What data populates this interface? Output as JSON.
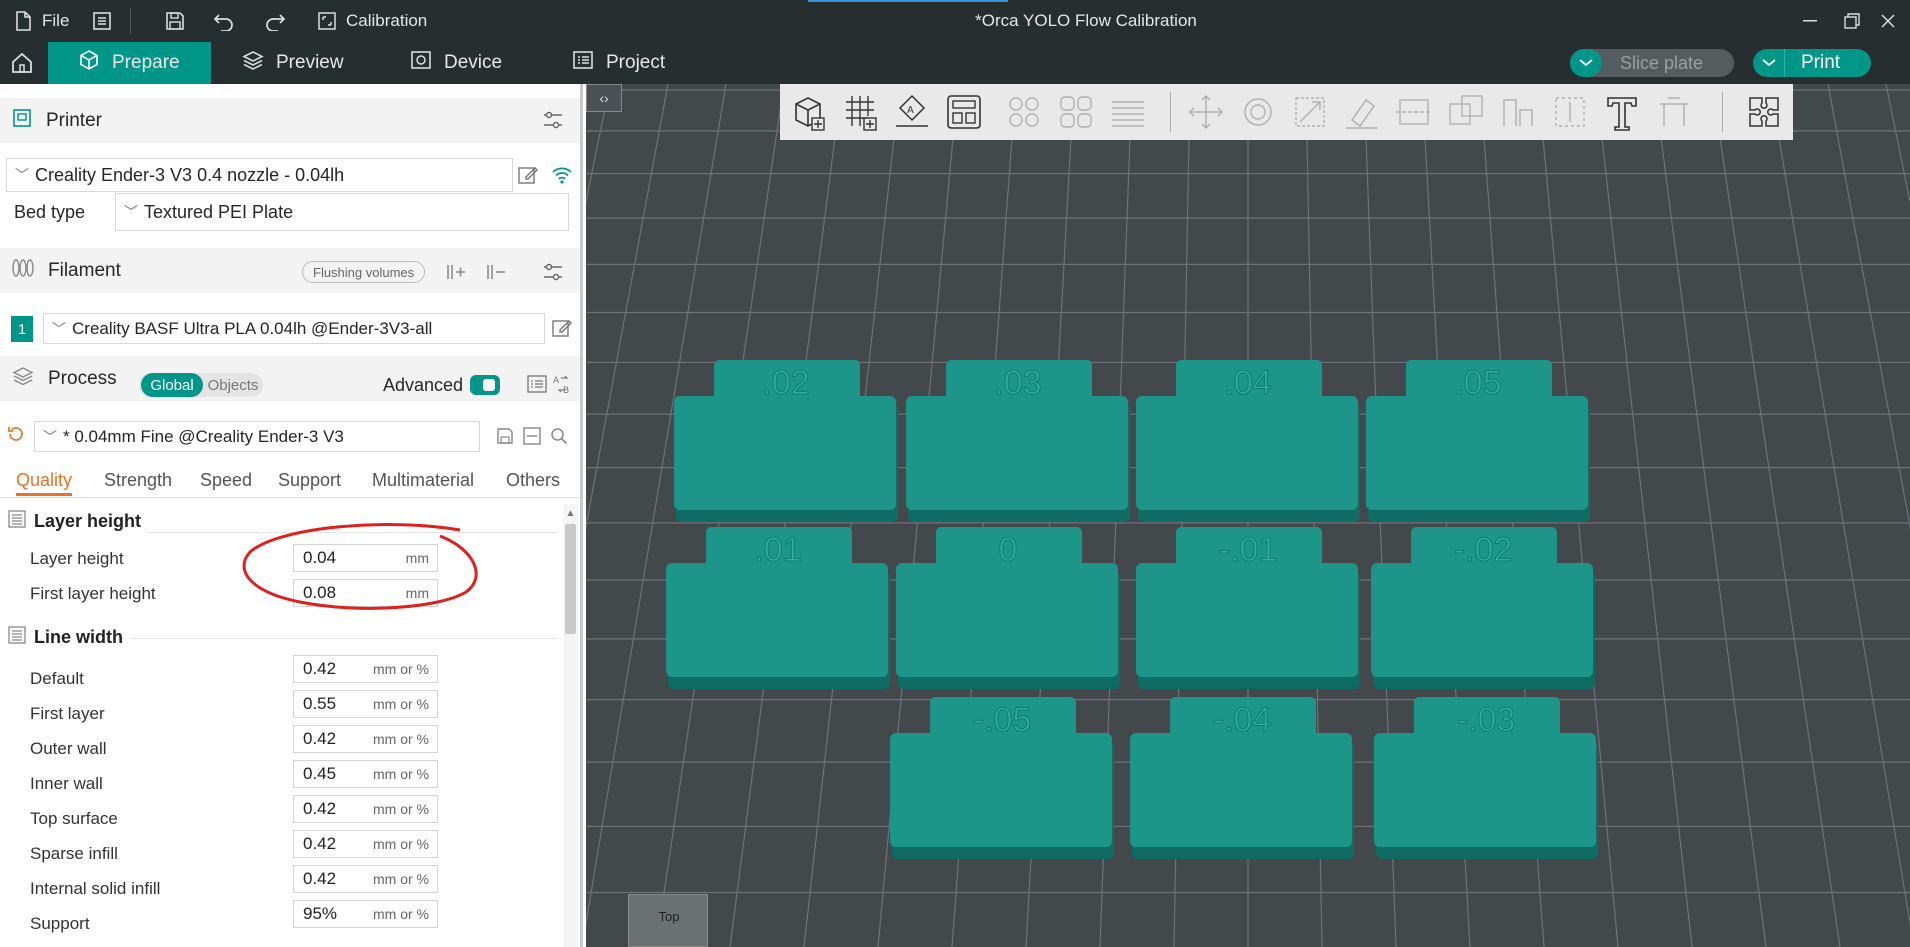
{
  "title_bar": {
    "file_label": "File",
    "calibration_label": "Calibration",
    "window_title": "*Orca YOLO Flow Calibration"
  },
  "tabs": [
    {
      "label": "Prepare",
      "icon": "cube-icon"
    },
    {
      "label": "Preview",
      "icon": "layers-icon"
    },
    {
      "label": "Device",
      "icon": "device-icon"
    },
    {
      "label": "Project",
      "icon": "project-icon"
    }
  ],
  "actions": {
    "slice_label": "Slice plate",
    "print_label": "Print"
  },
  "printer": {
    "section_label": "Printer",
    "preset": "Creality Ender-3 V3 0.4 nozzle - 0.04lh",
    "bed_type_label": "Bed type",
    "bed_type_value": "Textured PEI Plate"
  },
  "filament": {
    "section_label": "Filament",
    "flushing_label": "Flushing volumes",
    "slot_number": "1",
    "preset": "Creality BASF Ultra PLA 0.04lh @Ender-3V3-all"
  },
  "process": {
    "section_label": "Process",
    "global_label": "Global",
    "objects_label": "Objects",
    "advanced_label": "Advanced",
    "preset": "* 0.04mm Fine @Creality Ender-3 V3"
  },
  "subtabs": [
    "Quality",
    "Strength",
    "Speed",
    "Support",
    "Multimaterial",
    "Others"
  ],
  "groups": {
    "layer_height": {
      "title": "Layer height",
      "rows": [
        {
          "label": "Layer height",
          "value": "0.04",
          "unit": "mm"
        },
        {
          "label": "First layer height",
          "value": "0.08",
          "unit": "mm"
        }
      ]
    },
    "line_width": {
      "title": "Line width",
      "rows": [
        {
          "label": "Default",
          "value": "0.42",
          "unit": "mm or %"
        },
        {
          "label": "First layer",
          "value": "0.55",
          "unit": "mm or %"
        },
        {
          "label": "Outer wall",
          "value": "0.42",
          "unit": "mm or %"
        },
        {
          "label": "Inner wall",
          "value": "0.45",
          "unit": "mm or %"
        },
        {
          "label": "Top surface",
          "value": "0.42",
          "unit": "mm or %"
        },
        {
          "label": "Sparse infill",
          "value": "0.42",
          "unit": "mm or %"
        },
        {
          "label": "Internal solid infill",
          "value": "0.42",
          "unit": "mm or %"
        },
        {
          "label": "Support",
          "value": "95%",
          "unit": "mm or %"
        }
      ]
    }
  },
  "viewport": {
    "view_label": "Top",
    "tiles": [
      ".02",
      ".03",
      ".04",
      ".05",
      ".01",
      "0",
      "-.01",
      "-.02",
      "-.05",
      "-.04",
      "-.03"
    ]
  },
  "colors": {
    "accent": "#009688",
    "titlebar": "#262e30",
    "viewport": "#43484b",
    "tile": "#1d9589",
    "annotation": "#e0201f"
  }
}
